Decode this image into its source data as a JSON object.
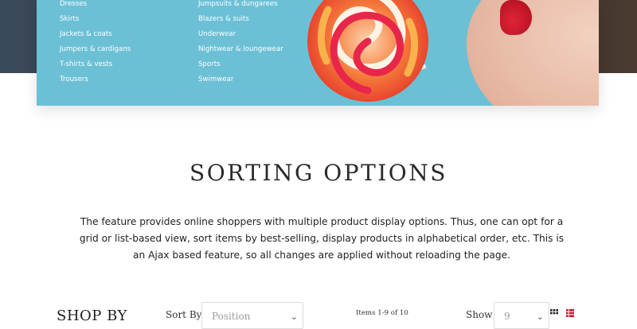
{
  "menu": {
    "column1": [
      "Dresses",
      "Skirts",
      "Jackets & coats",
      "Jumpers & cardigans",
      "T-shirts & vests",
      "Trousers"
    ],
    "column2": [
      "Jumpsuits & dungarees",
      "Blazers & suits",
      "Underwear",
      "Nightwear & loungewear",
      "Sports",
      "Swimwear"
    ]
  },
  "feature": {
    "title": "SORTING OPTIONS",
    "description": "The feature provides online shoppers with multiple product display options. Thus, one can opt for a grid or list-based view, sort items by best-selling, display products in alphabetical order, etc. This is an Ajax based feature, so all changes are applied without reloading the page."
  },
  "toolbar": {
    "shop_by": "SHOP BY",
    "sort_label": "Sort By",
    "sort_value": "Position",
    "items_count": "Items 1-9 of 10",
    "show_label": "Show",
    "show_value": "9",
    "chevron_glyph": "⌄"
  },
  "colors": {
    "banner_bg": "#6cc0d6",
    "grid_icon": "#222222",
    "list_icon": "#d0142c"
  }
}
